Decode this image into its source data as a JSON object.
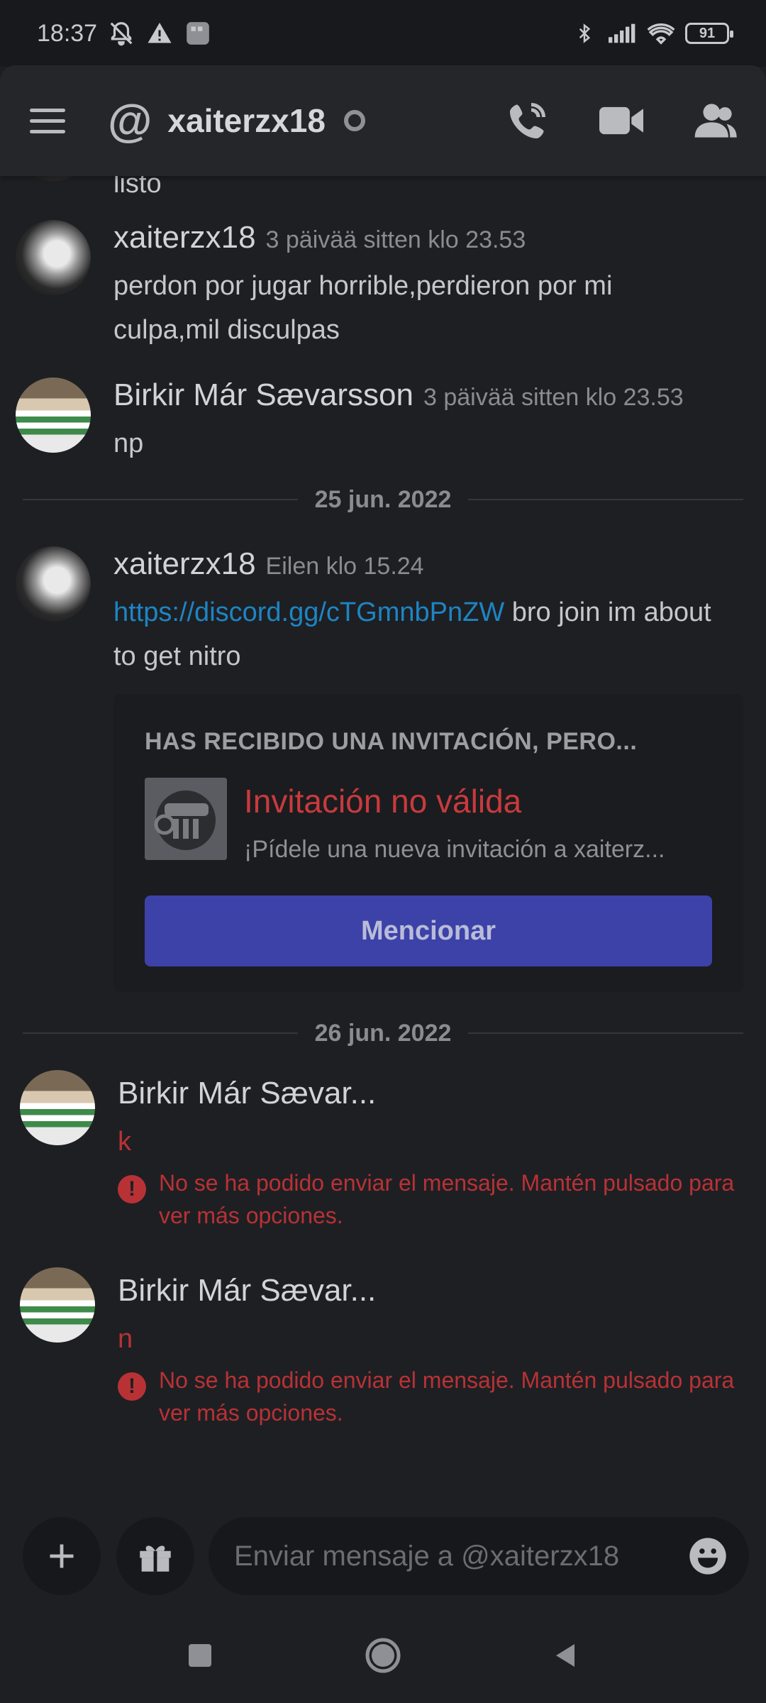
{
  "status_bar": {
    "time": "18:37",
    "battery": "91"
  },
  "header": {
    "channel_name": "xaiterzx18"
  },
  "messages": [
    {
      "text": "listo"
    },
    {
      "author": "xaiterzx18",
      "timestamp": "3 päivää sitten klo 23.53",
      "text": "perdon por jugar horrible,perdieron por mi culpa,mil disculpas"
    },
    {
      "author": "Birkir Már Sævarsson",
      "timestamp": "3 päivää sitten klo 23.53",
      "text": "np"
    },
    {
      "author": "xaiterzx18",
      "timestamp": "Eilen klo 15.24",
      "link": "https://discord.gg/cTGmnbPnZW",
      "text_after_link": " bro join im about to get nitro"
    },
    {
      "author": "Birkir Már Sævar...",
      "text": "k",
      "error": "No se ha podido enviar el mensaje. Mantén pulsado para ver más opciones."
    },
    {
      "author": "Birkir Már Sævar...",
      "text": "n",
      "error": "No se ha podido enviar el mensaje. Mantén pulsado para ver más opciones."
    }
  ],
  "dividers": [
    "25 jun. 2022",
    "26 jun. 2022"
  ],
  "invite": {
    "heading": "HAS RECIBIDO UNA INVITACIÓN, PERO...",
    "title": "Invitación no válida",
    "subtitle": "¡Pídele una nueva invitación a xaiterz...",
    "button": "Mencionar"
  },
  "composer": {
    "placeholder": "Enviar mensaje a @xaiterzx18"
  },
  "colors": {
    "background": "#1e1f23",
    "header": "#25262a",
    "link": "#1d85c4",
    "error": "#b83235",
    "button": "#3c42a8"
  },
  "icons": [
    "muted-bell-icon",
    "warning-icon",
    "app-icon",
    "bluetooth-icon",
    "signal-icon",
    "wifi-icon",
    "hamburger-icon",
    "at-icon",
    "call-icon",
    "video-icon",
    "members-icon",
    "plus-icon",
    "gift-icon",
    "emoji-icon",
    "nav-recents-icon",
    "nav-home-icon",
    "nav-back-icon"
  ]
}
